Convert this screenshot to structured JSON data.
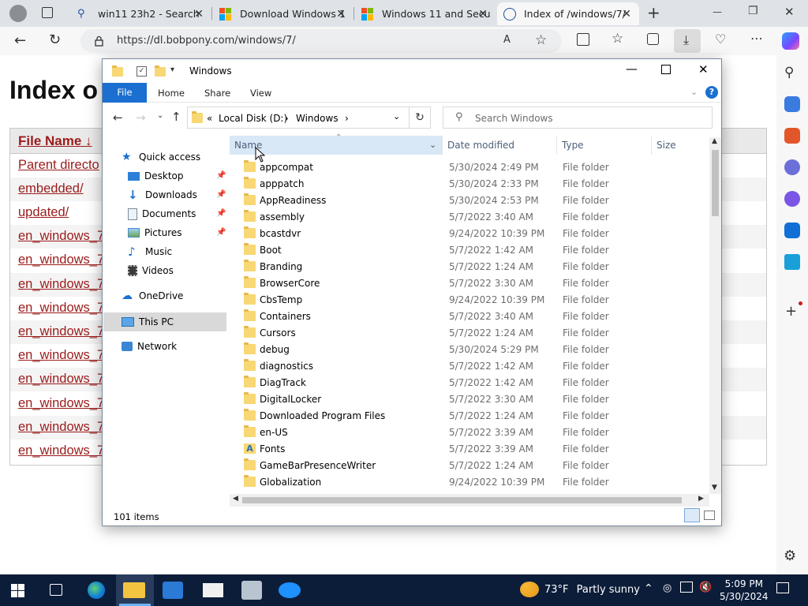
{
  "browser": {
    "tabs": [
      {
        "title": "win11 23h2 - Search",
        "icon": "search-icon"
      },
      {
        "title": "Download Windows 1",
        "icon": "microsoft-logo-icon"
      },
      {
        "title": "Windows 11 and Secu",
        "icon": "microsoft-logo-icon"
      },
      {
        "title": "Index of /windows/7/",
        "icon": "page-icon"
      }
    ],
    "new_tab": "+",
    "url": "https://dl.bobpony.com/windows/7/",
    "win_min": "—",
    "win_max": "❐",
    "win_close": "✕"
  },
  "webpage": {
    "heading": "Index o",
    "column_header": "File Name ↓",
    "rows": [
      "Parent directo",
      "embedded/",
      "updated/",
      "en_windows_7",
      "en_windows_7",
      "en_windows_7",
      "en_windows_7",
      "en_windows_7",
      "en_windows_7",
      "en_windows_7",
      "en_windows_7",
      "en_windows_7",
      "en_windows_7"
    ]
  },
  "explorer": {
    "title": "Windows",
    "ribbon_tabs": {
      "file": "File",
      "home": "Home",
      "share": "Share",
      "view": "View"
    },
    "breadcrumb": {
      "root": "Local Disk (D:)",
      "current": "Windows",
      "sep": "›",
      "lead": "«"
    },
    "search_placeholder": "Search Windows",
    "nav": {
      "quick_access": "Quick access",
      "desktop": "Desktop",
      "downloads": "Downloads",
      "documents": "Documents",
      "pictures": "Pictures",
      "music": "Music",
      "videos": "Videos",
      "onedrive": "OneDrive",
      "this_pc": "This PC",
      "network": "Network"
    },
    "columns": {
      "name": "Name",
      "date": "Date modified",
      "type": "Type",
      "size": "Size"
    },
    "files": [
      {
        "name": "appcompat",
        "date": "5/30/2024 2:49 PM",
        "type": "File folder"
      },
      {
        "name": "apppatch",
        "date": "5/30/2024 2:33 PM",
        "type": "File folder"
      },
      {
        "name": "AppReadiness",
        "date": "5/30/2024 2:53 PM",
        "type": "File folder"
      },
      {
        "name": "assembly",
        "date": "5/7/2022 3:40 AM",
        "type": "File folder"
      },
      {
        "name": "bcastdvr",
        "date": "9/24/2022 10:39 PM",
        "type": "File folder"
      },
      {
        "name": "Boot",
        "date": "5/7/2022 1:42 AM",
        "type": "File folder"
      },
      {
        "name": "Branding",
        "date": "5/7/2022 1:24 AM",
        "type": "File folder"
      },
      {
        "name": "BrowserCore",
        "date": "5/7/2022 3:30 AM",
        "type": "File folder"
      },
      {
        "name": "CbsTemp",
        "date": "9/24/2022 10:39 PM",
        "type": "File folder"
      },
      {
        "name": "Containers",
        "date": "5/7/2022 3:40 AM",
        "type": "File folder"
      },
      {
        "name": "Cursors",
        "date": "5/7/2022 1:24 AM",
        "type": "File folder"
      },
      {
        "name": "debug",
        "date": "5/30/2024 5:29 PM",
        "type": "File folder"
      },
      {
        "name": "diagnostics",
        "date": "5/7/2022 1:42 AM",
        "type": "File folder"
      },
      {
        "name": "DiagTrack",
        "date": "5/7/2022 1:42 AM",
        "type": "File folder"
      },
      {
        "name": "DigitalLocker",
        "date": "5/7/2022 3:30 AM",
        "type": "File folder"
      },
      {
        "name": "Downloaded Program Files",
        "date": "5/7/2022 1:24 AM",
        "type": "File folder"
      },
      {
        "name": "en-US",
        "date": "5/7/2022 3:39 AM",
        "type": "File folder"
      },
      {
        "name": "Fonts",
        "date": "5/7/2022 3:39 AM",
        "type": "File folder"
      },
      {
        "name": "GameBarPresenceWriter",
        "date": "5/7/2022 1:24 AM",
        "type": "File folder"
      },
      {
        "name": "Globalization",
        "date": "9/24/2022 10:39 PM",
        "type": "File folder"
      }
    ],
    "status": "101 items"
  },
  "taskbar": {
    "weather_temp": "73°F",
    "weather_text": "Partly sunny",
    "time": "5:09 PM",
    "date": "5/30/2024"
  },
  "colors": {
    "accent": "#1a6fd0",
    "link": "#9b1b1b",
    "taskbar": "#0c1d3a"
  }
}
